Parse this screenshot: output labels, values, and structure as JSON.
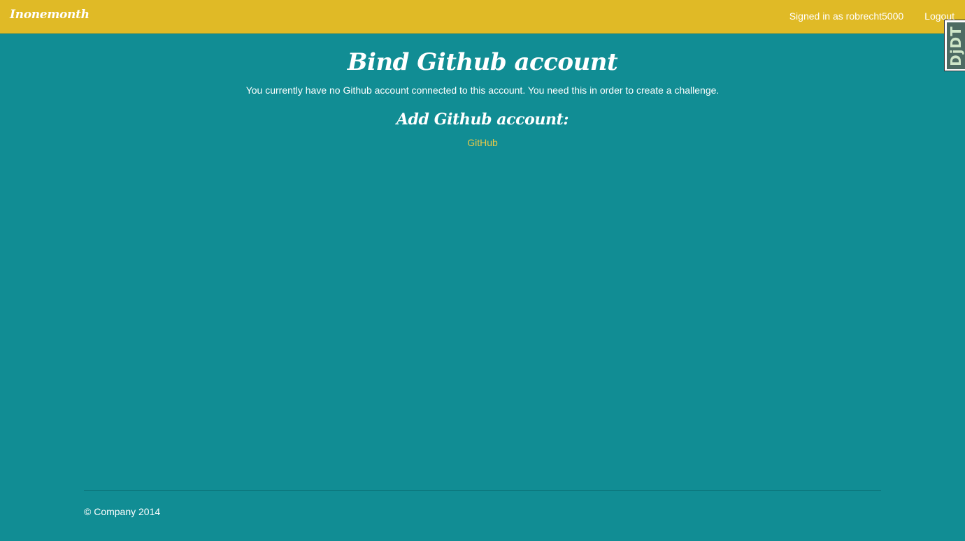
{
  "navbar": {
    "brand": "Inonemonth",
    "signed_in": "Signed in as robrecht5000",
    "logout": "Logout"
  },
  "debug_toolbar": {
    "handle_label": "DjDT"
  },
  "main": {
    "title": "Bind Github account",
    "description": "You currently have no Github account connected to this account. You need this in order to create a challenge.",
    "subtitle": "Add Github account:",
    "provider_link": "GitHub"
  },
  "footer": {
    "copyright": "© Company 2014"
  },
  "colors": {
    "navbar_bg": "#e0ba26",
    "page_bg": "#118d94",
    "link": "#e7c94a"
  }
}
